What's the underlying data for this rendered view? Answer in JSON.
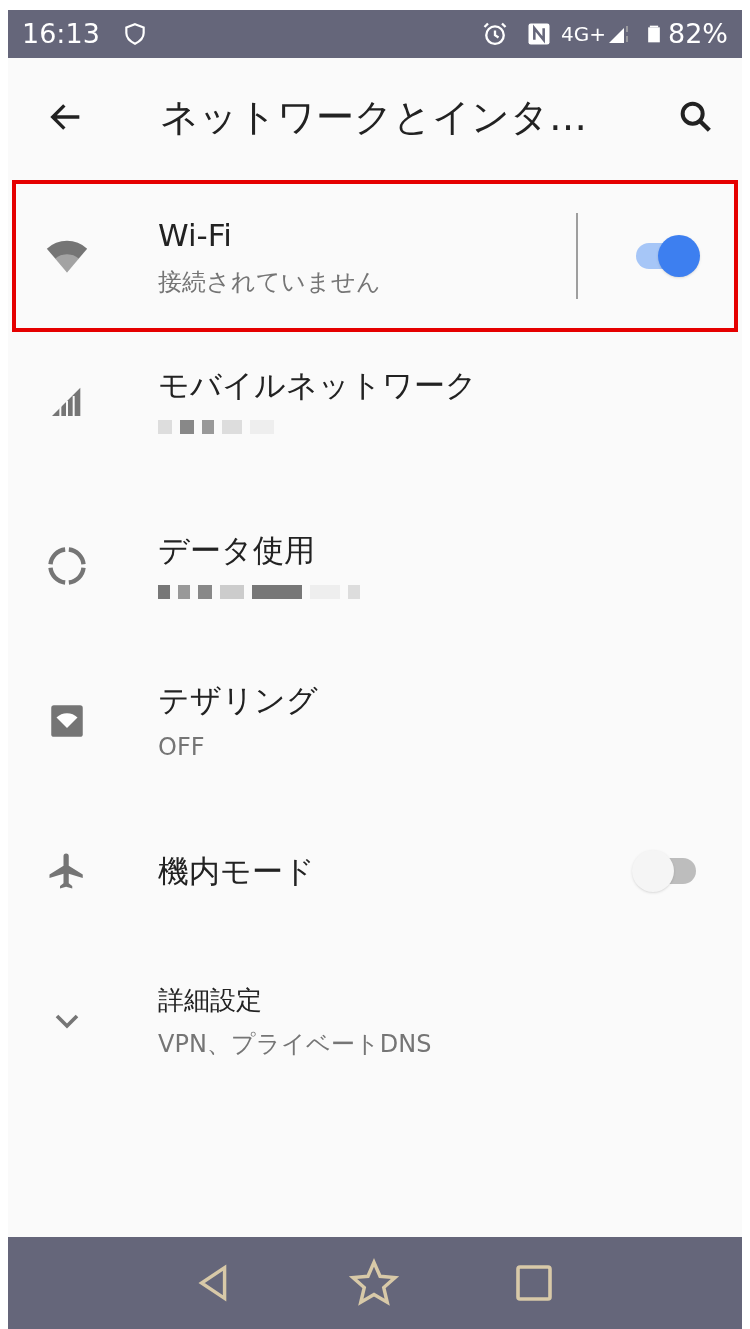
{
  "status_bar": {
    "time": "16:13",
    "network": "4G+",
    "battery": "82%"
  },
  "app_bar": {
    "title": "ネットワークとインタ…"
  },
  "items": [
    {
      "kind": "split-switch",
      "title": "Wi-Fi",
      "subtitle": "接続されていません",
      "on": true,
      "highlighted": true
    },
    {
      "kind": "plain",
      "title": "モバイルネットワーク",
      "subtitle_redacted": true,
      "highlighted": false
    },
    {
      "kind": "plain",
      "title": "データ使用",
      "subtitle_redacted": true,
      "highlighted": false
    },
    {
      "kind": "plain",
      "title": "テザリング",
      "subtitle": "OFF",
      "highlighted": false
    },
    {
      "kind": "switch",
      "title": "機内モード",
      "on": false,
      "highlighted": false
    },
    {
      "kind": "expand",
      "title": "詳細設定",
      "subtitle": "VPN、プライベートDNS",
      "highlighted": false
    }
  ]
}
